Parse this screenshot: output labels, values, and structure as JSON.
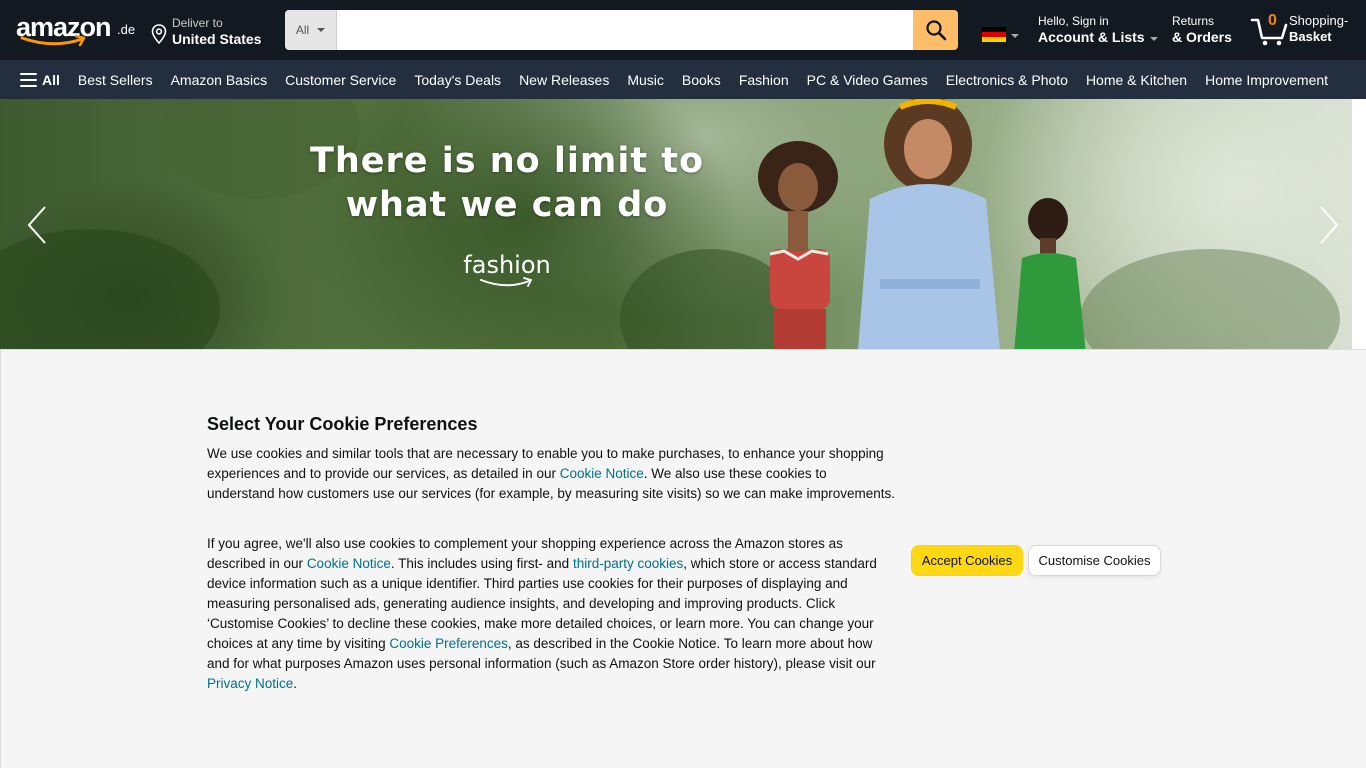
{
  "header": {
    "logo_text": "amazon",
    "logo_tld": ".de",
    "deliver": {
      "line1": "Deliver to",
      "line2": "United States"
    },
    "search": {
      "category": "All",
      "value": "",
      "placeholder": ""
    },
    "account": {
      "line1": "Hello, Sign in",
      "line2": "Account & Lists"
    },
    "returns": {
      "line1": "Returns",
      "line2": "& Orders"
    },
    "basket": {
      "count": "0",
      "line1": "Shopping-",
      "line2": "Basket"
    },
    "flag_colors": [
      "#000000",
      "#dd0000",
      "#ffce00"
    ]
  },
  "nav": {
    "all_label": "All",
    "links": [
      "Best Sellers",
      "Amazon Basics",
      "Customer Service",
      "Today's Deals",
      "New Releases",
      "Music",
      "Books",
      "Fashion",
      "PC & Video Games",
      "Electronics & Photo",
      "Home & Kitchen",
      "Home Improvement"
    ]
  },
  "hero": {
    "headline_line1": "There is no limit to",
    "headline_line2": "what we can do",
    "brand": "fashion"
  },
  "cookie": {
    "title": "Select Your Cookie Preferences",
    "p1": {
      "t1": "We use cookies and similar tools that are necessary to enable you to make purchases, to enhance your shopping experiences and to provide our services, as detailed in our ",
      "link1": "Cookie Notice",
      "t2": ". We also use these cookies to understand how customers use our services (for example, by measuring site visits) so we can make improvements."
    },
    "p2": {
      "t1": "If you agree, we'll also use cookies to complement your shopping experience across the Amazon stores as described in our ",
      "link1": "Cookie Notice",
      "t2": ". This includes using first- and ",
      "link2": "third-party cookies",
      "t3": ", which store or access standard device information such as a unique identifier. Third parties use cookies for their purposes of displaying and measuring personalised ads, generating audience insights, and developing and improving products. Click ‘Customise Cookies’ to decline these cookies, make more detailed choices, or learn more. You can change your choices at any time by visiting ",
      "link3": "Cookie Preferences",
      "t4": ", as described in the Cookie Notice. To learn more about how and for what purposes Amazon uses personal information (such as Amazon Store order history), please visit our ",
      "link4": "Privacy Notice",
      "t5": "."
    },
    "accept_label": "Accept Cookies",
    "customise_label": "Customise Cookies"
  },
  "colors": {
    "header_bg": "#131921",
    "nav_bg": "#232f3e",
    "search_button": "#febd69",
    "accept_button": "#ffd814",
    "link": "#007185",
    "basket_count": "#f08804"
  }
}
